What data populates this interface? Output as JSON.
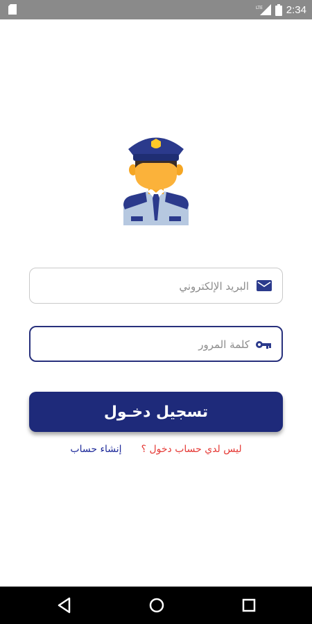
{
  "status_bar": {
    "time": "2:34",
    "network_label": "LTE"
  },
  "login": {
    "email_placeholder": "البريد الإلكتروني",
    "password_placeholder": "كلمة المرور",
    "submit_label": "تسجيل دخـول",
    "no_account_text": "ليس لدي حساب دخول ؟",
    "create_account_link": "إنشاء حساب"
  },
  "colors": {
    "primary": "#1e2a7a",
    "link_red": "#e53935",
    "link_blue": "#1e2a9a",
    "status_bar": "#8a8a8a",
    "nav_bar": "#000000"
  },
  "icons": {
    "status": [
      "sd-card-icon",
      "lte-signal-icon",
      "battery-icon"
    ],
    "fields": [
      "envelope-icon",
      "key-icon"
    ],
    "nav": [
      "back-icon",
      "home-icon",
      "recents-icon"
    ]
  }
}
